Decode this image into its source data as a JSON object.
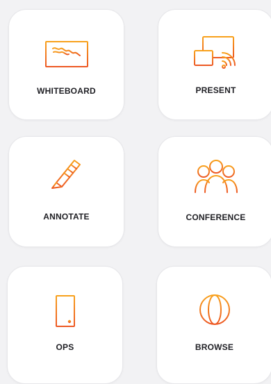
{
  "colors": {
    "accent_start": "#f8a11b",
    "accent_end": "#ed5722",
    "tile_background": "#ffffff",
    "page_background": "#f2f2f4",
    "label_text": "#1f1f24"
  },
  "tiles": [
    {
      "label": "WHITEBOARD",
      "icon": "whiteboard-icon"
    },
    {
      "label": "PRESENT",
      "icon": "present-cast-icon"
    },
    {
      "label": "ANNOTATE",
      "icon": "pencil-icon"
    },
    {
      "label": "CONFERENCE",
      "icon": "people-group-icon"
    },
    {
      "label": "OPS",
      "icon": "server-tower-icon"
    },
    {
      "label": "BROWSE",
      "icon": "globe-icon"
    }
  ]
}
